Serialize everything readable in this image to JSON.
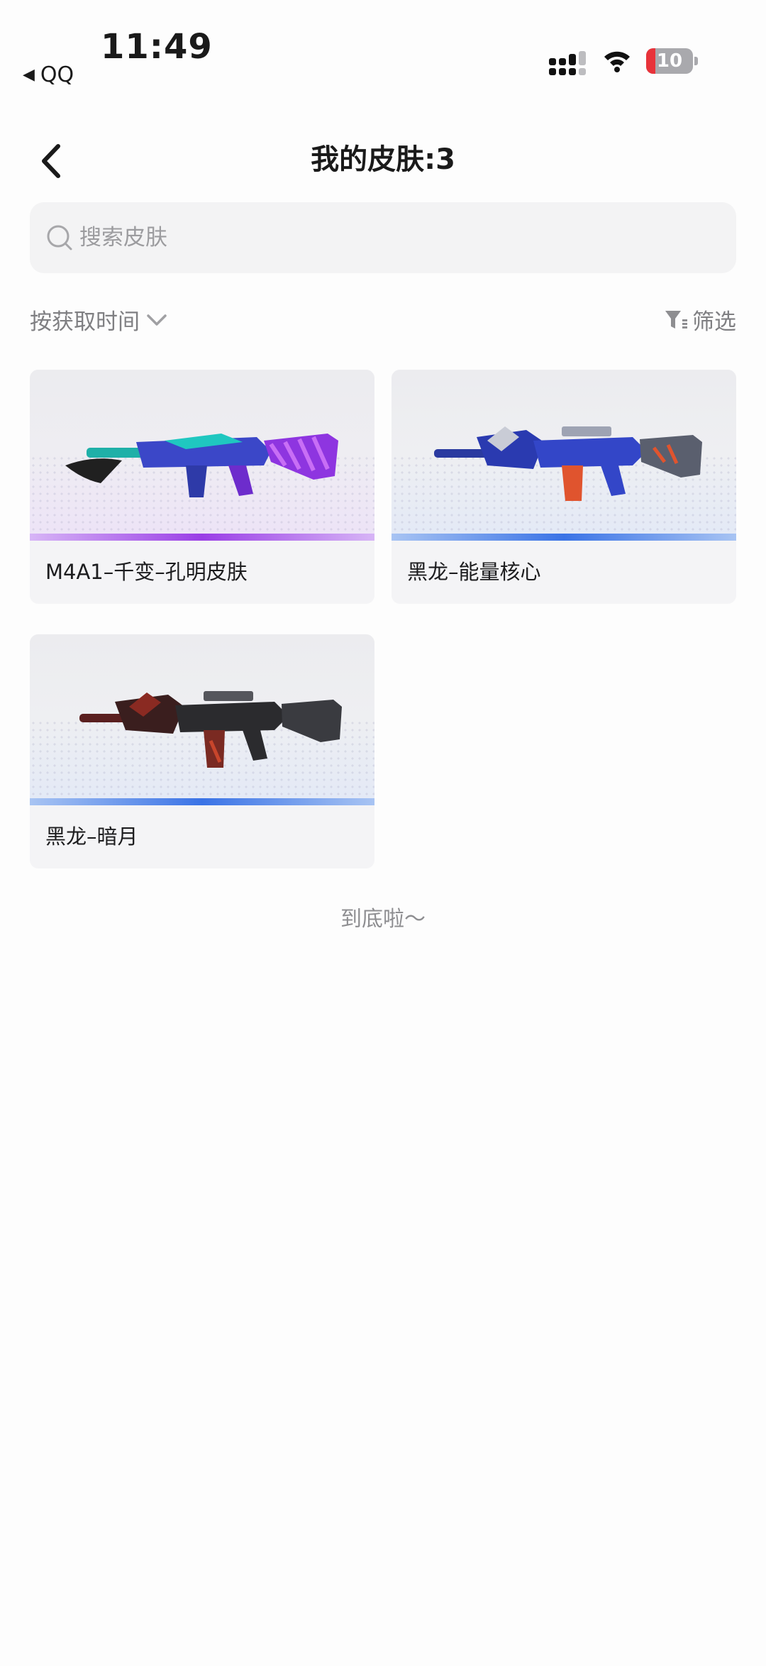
{
  "status_bar": {
    "time": "11:49",
    "back_app_label": "QQ",
    "battery_level": "10",
    "battery_fraction": 0.1
  },
  "nav": {
    "title": "我的皮肤:3",
    "back_icon": "chevron-left-icon"
  },
  "search": {
    "placeholder": "搜索皮肤",
    "icon": "search-icon"
  },
  "toolbar": {
    "sort_label": "按获取时间",
    "filter_label": "筛选"
  },
  "skins": [
    {
      "name": "M4A1–千变–孔明皮肤",
      "rarity_color": "#9a3ee6"
    },
    {
      "name": "黑龙–能量核心",
      "rarity_color": "#3a73e6"
    },
    {
      "name": "黑龙–暗月",
      "rarity_color": "#3a73e6"
    }
  ],
  "footer": {
    "end_text": "到底啦～"
  }
}
